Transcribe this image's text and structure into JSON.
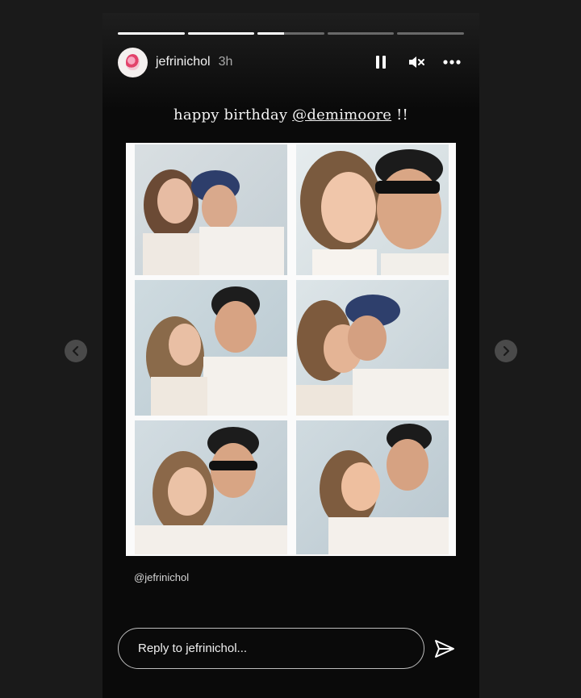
{
  "story": {
    "progress": [
      1,
      1,
      0.4,
      0,
      0
    ],
    "user": {
      "username": "jefrinichol",
      "time_ago": "3h"
    },
    "controls": {
      "pause_icon": "pause-icon",
      "mute_icon": "muted-speaker-icon",
      "more_icon": "more-horizontal-icon"
    },
    "caption": {
      "prefix": "happy birthday ",
      "mention": "@demimoore",
      "suffix": " !!"
    },
    "credit": "@jefrinichol",
    "reply": {
      "placeholder": "Reply to jefrinichol..."
    },
    "send_icon": "send-paper-plane-icon"
  },
  "navigation": {
    "prev_icon": "chevron-left-icon",
    "next_icon": "chevron-right-icon"
  },
  "colors": {
    "background": "#1a1a1a",
    "story_background": "#0a0a0a",
    "text": "#f2f2f2"
  }
}
